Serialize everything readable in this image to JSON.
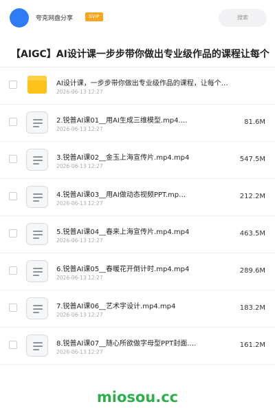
{
  "header": {
    "app_name": "夸克网盘分享",
    "badge": "SVIP",
    "search_placeholder": "搜索",
    "avatar_color": "#2f7cf6"
  },
  "title": "【AIGC】AI设计课一步步带你做出专业级作品的课程让每个",
  "items": [
    {
      "type": "folder",
      "name": "AI设计课，一步步带你做出专业级作品的课程，让每个…",
      "date": "2026-06-13 12:27",
      "size": ""
    },
    {
      "type": "file",
      "name": "2.锐普AI课01__用AI生成三维模型.mp4.…",
      "date": "2026-06-13 12:27",
      "size": "81.6M"
    },
    {
      "type": "file",
      "name": "3.锐普AI课02__金玉上海宣传片.mp4.mp4",
      "date": "2026-06-13 12:27",
      "size": "547.5M"
    },
    {
      "type": "file",
      "name": "4.锐普AI课03__用AI做动态视频PPT.mp…",
      "date": "2026-06-13 12:27",
      "size": "212.2M"
    },
    {
      "type": "file",
      "name": "5.锐普AI课04__春来上海宣传片.mp4.mp4",
      "date": "2026-06-13 12:27",
      "size": "463.5M"
    },
    {
      "type": "file",
      "name": "6.锐普AI课05__春暖花开倒计时.mp4.mp4",
      "date": "2026-06-13 12:27",
      "size": "289.6M"
    },
    {
      "type": "file",
      "name": "7.锐普AI课06__艺术字设计.mp4.mp4",
      "date": "2026-06-13 12:27",
      "size": "183.2M"
    },
    {
      "type": "file",
      "name": "8.锐普AI课07__随心所欲做字母型PPT封面.…",
      "date": "2026-06-13 12:27",
      "size": "161.2M"
    }
  ],
  "watermark": "miosou.cc"
}
